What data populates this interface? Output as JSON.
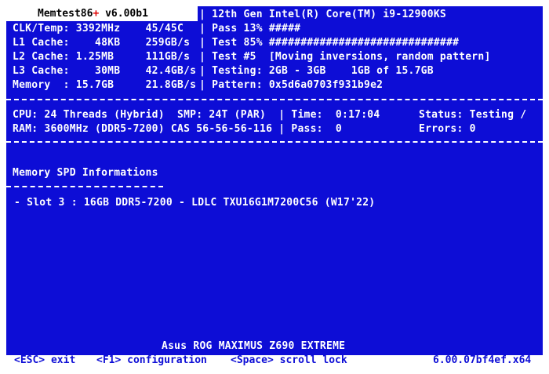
{
  "header": {
    "app_name": "Memtest86",
    "plus": "+",
    "version": "v6.00b1",
    "cpu_model": "| 12th Gen Intel(R) Core(TM) i9-12900KS"
  },
  "stats_left": [
    "CLK/Temp: 3392MHz    45/45C",
    "L1 Cache:    48KB    259GB/s",
    "L2 Cache: 1.25MB     111GB/s",
    "L3 Cache:    30MB    42.4GB/s",
    "Memory  : 15.7GB     21.8GB/s"
  ],
  "stats_right": [
    "| Pass 13% #####",
    "| Test 85% ##############################",
    "| Test #5  [Moving inversions, random pattern]",
    "| Testing: 2GB - 3GB    1GB of 15.7GB",
    "| Pattern: 0x5d6a0703f931b9e2"
  ],
  "pass_progress": 0.13,
  "test_progress": 0.85,
  "system": {
    "cpu_line": "CPU: 24 Threads (Hybrid)  SMP: 24T (PAR)  | Time:  0:17:04",
    "status": "Status: Testing /",
    "ram_line": "RAM: 3600MHz (DDR5-7200) CAS 56-56-56-116 | Pass:  0",
    "errors": "Errors: 0"
  },
  "spd": {
    "heading": "Memory SPD Informations",
    "slot": "- Slot 3 : 16GB DDR5-7200 - LDLC TXU16G1M7200C56 (W17'22)"
  },
  "board": "Asus ROG MAXIMUS Z690 EXTREME",
  "footer": {
    "exit": "<ESC> exit",
    "config": "<F1> configuration",
    "scroll": "<Space> scroll lock",
    "build": "6.00.07bf4ef.x64"
  },
  "colors": {
    "background": "#0d0dd6",
    "text": "#ffffff",
    "accent_plus": "#e00000"
  }
}
